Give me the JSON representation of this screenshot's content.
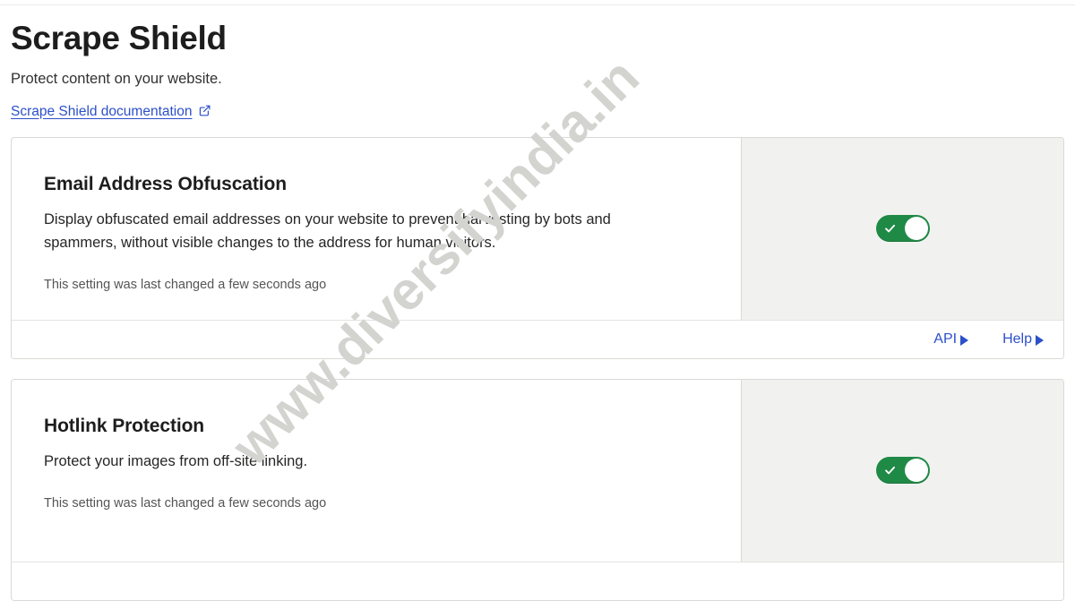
{
  "header": {
    "title": "Scrape Shield",
    "subtitle": "Protect content on your website.",
    "doc_link_label": "Scrape Shield documentation",
    "doc_link_icon": "external-link-icon"
  },
  "theme": {
    "link_color": "#2c50c8",
    "toggle_on_color": "#1f8a46",
    "control_panel_bg": "#f1f2f0",
    "card_border": "#d9d9d6",
    "watermark_color": "#d3d4d0"
  },
  "cards": [
    {
      "title": "Email Address Obfuscation",
      "description": "Display obfuscated email addresses on your website to prevent harvesting by bots and spammers, without visible changes to the address for human visitors.",
      "note": "This setting was last changed a few seconds ago",
      "toggle": {
        "state": "on",
        "icon": "check-icon"
      },
      "footer": {
        "api_label": "API",
        "help_label": "Help"
      }
    },
    {
      "title": "Hotlink Protection",
      "description": "Protect your images from off-site linking.",
      "note": "This setting was last changed a few seconds ago",
      "toggle": {
        "state": "on",
        "icon": "check-icon"
      }
    }
  ],
  "watermark": {
    "text": "www.diversifyindia.in"
  }
}
